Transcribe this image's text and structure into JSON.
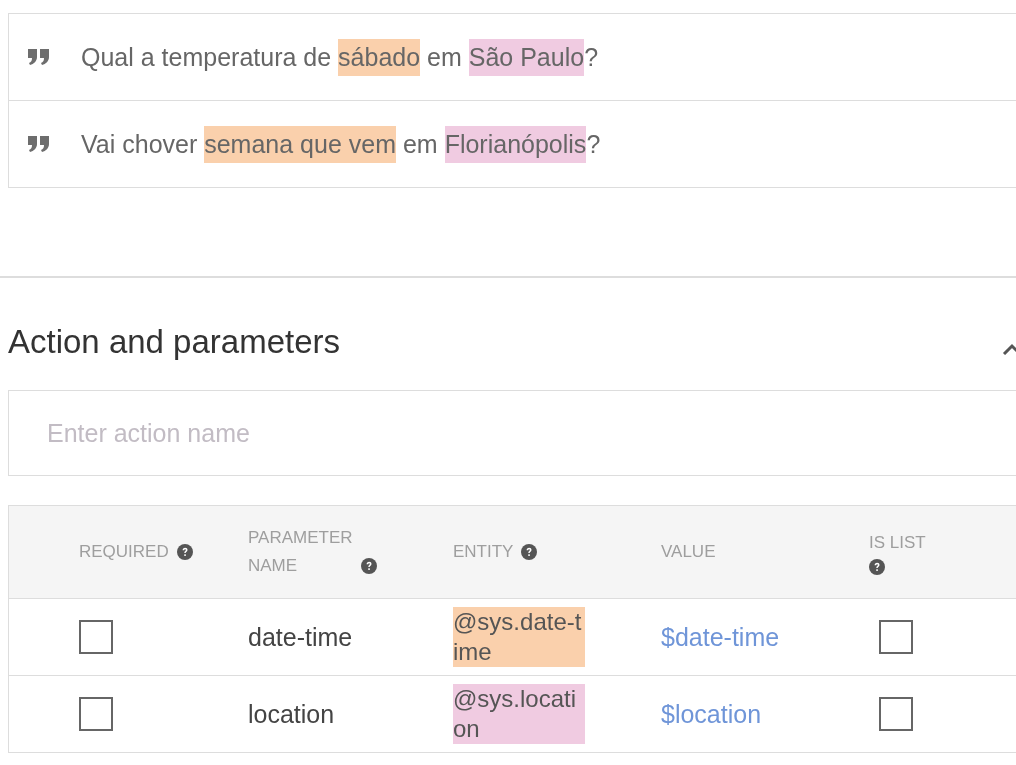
{
  "training_phrases": [
    {
      "segments": [
        {
          "text": "Qual a temperatura de "
        },
        {
          "text": "sábado",
          "color": "#fad0ac"
        },
        {
          "text": " em "
        },
        {
          "text": "São Paulo",
          "color": "#f0cbe1"
        },
        {
          "text": "?"
        }
      ]
    },
    {
      "segments": [
        {
          "text": "Vai chover "
        },
        {
          "text": "semana que vem",
          "color": "#fad0ac"
        },
        {
          "text": " em "
        },
        {
          "text": "Florianópolis",
          "color": "#f0cbe1"
        },
        {
          "text": "?"
        }
      ]
    }
  ],
  "section": {
    "title": "Action and parameters",
    "expanded": true
  },
  "action_field": {
    "placeholder": "Enter action name"
  },
  "table": {
    "columns": [
      {
        "label": "REQUIRED",
        "help": true
      },
      {
        "label": "PARAMETER NAME",
        "help": true
      },
      {
        "label": "ENTITY",
        "help": true
      },
      {
        "label": "VALUE",
        "help": false
      },
      {
        "label": "IS LIST",
        "help": true
      }
    ],
    "rows": [
      {
        "required": false,
        "name": "date-time",
        "entity": "@sys.date-time",
        "color": "#fad0ac",
        "value": "$date-time",
        "is_list": false
      },
      {
        "required": false,
        "name": "location",
        "entity": "@sys.location",
        "color": "#f0cbe1",
        "value": "$location",
        "is_list": false
      }
    ]
  }
}
